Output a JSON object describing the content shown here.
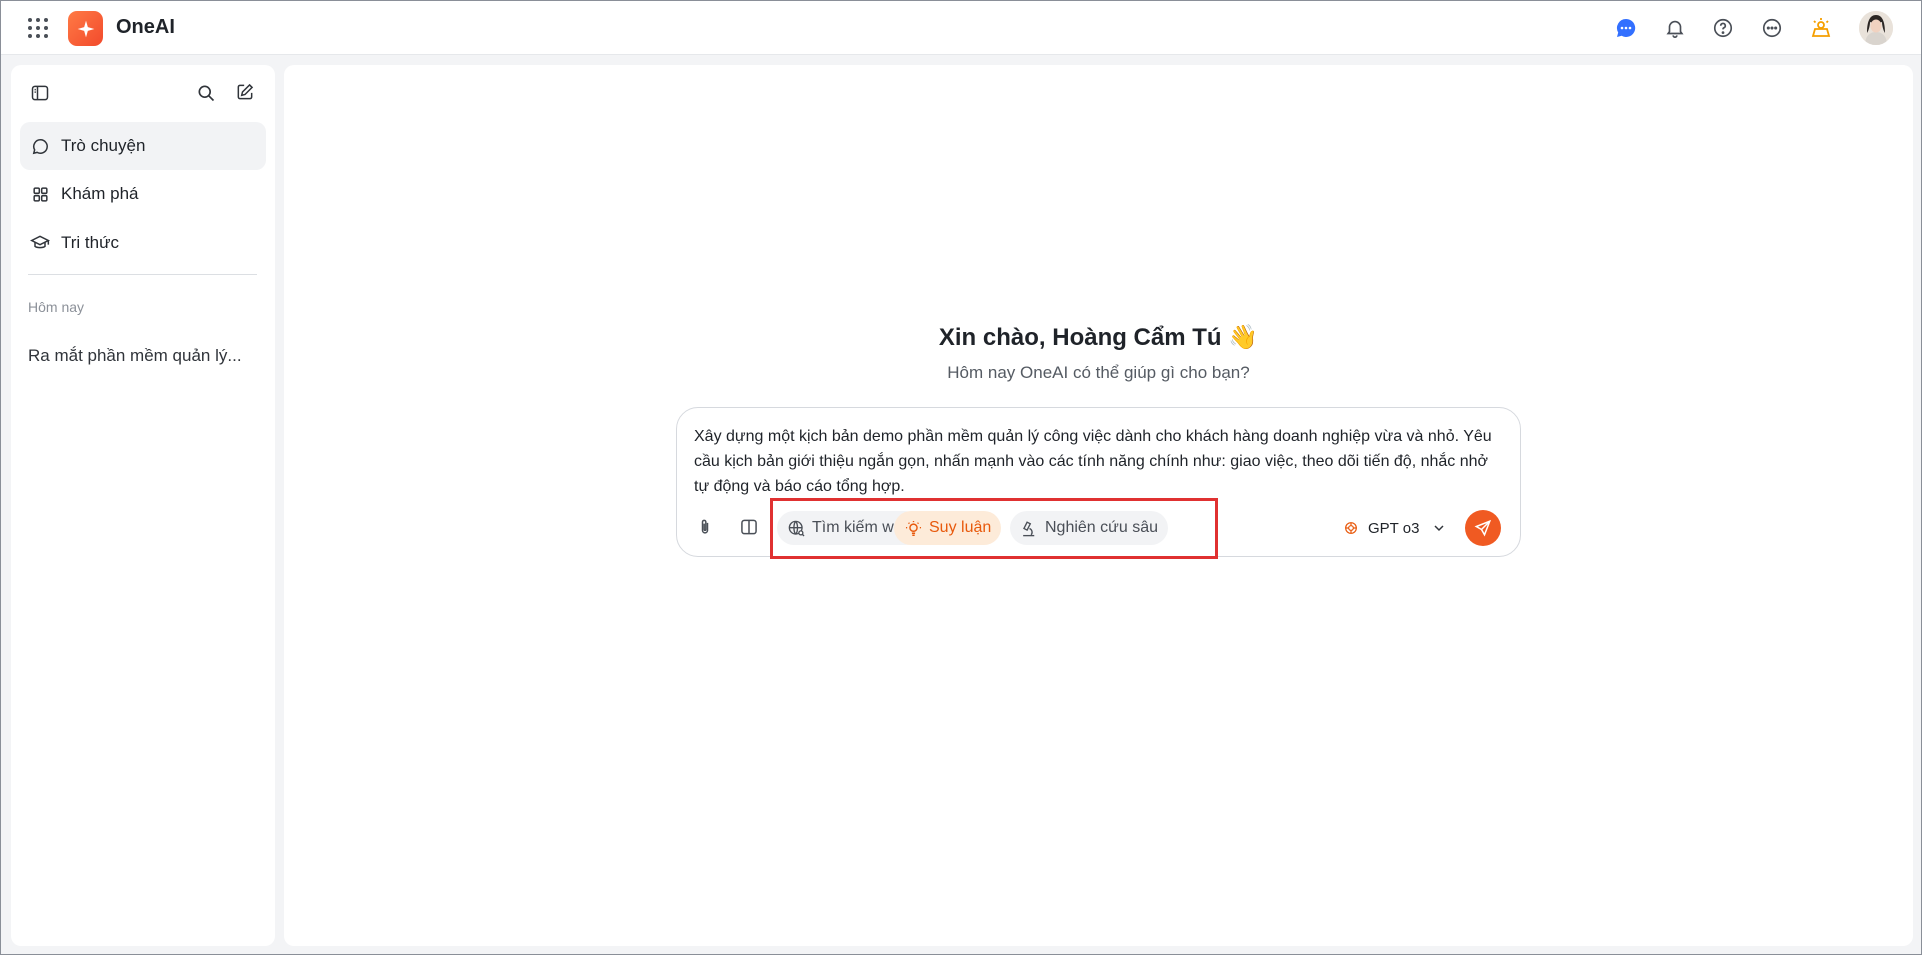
{
  "header": {
    "brand": "OneAI"
  },
  "sidebar": {
    "nav": [
      {
        "label": "Trò chuyện",
        "icon": "chat-bubble-icon"
      },
      {
        "label": "Khám phá",
        "icon": "grid-icon"
      },
      {
        "label": "Tri thức",
        "icon": "graduation-cap-icon"
      }
    ],
    "section_label": "Hôm nay",
    "history": [
      "Ra mắt phần mềm quản lý..."
    ]
  },
  "main": {
    "greeting": "Xin chào, Hoàng Cẩm Tú 👋",
    "subtitle": "Hôm nay OneAI có thể giúp gì cho bạn?",
    "composer": {
      "prompt": "Xây dựng một kịch bản demo phần mềm quản lý công việc dành cho khách hàng doanh nghiệp vừa và nhỏ. Yêu cầu kịch bản giới thiệu ngắn gọn, nhấn mạnh vào các tính năng chính như: giao việc, theo dõi tiến độ, nhắc nhở tự động và báo cáo tổng hợp.",
      "chips": [
        {
          "label": "Tìm kiếm web",
          "active": false
        },
        {
          "label": "Suy luận",
          "active": true
        },
        {
          "label": "Nghiên cứu sâu",
          "active": false
        }
      ],
      "model": "GPT o3"
    }
  },
  "colors": {
    "accent": "#f05a22",
    "active_chip_bg": "#fdebd9",
    "highlight_border": "#e03131",
    "notification_blue": "#3370ff",
    "lamp_orange": "#f59f00"
  }
}
